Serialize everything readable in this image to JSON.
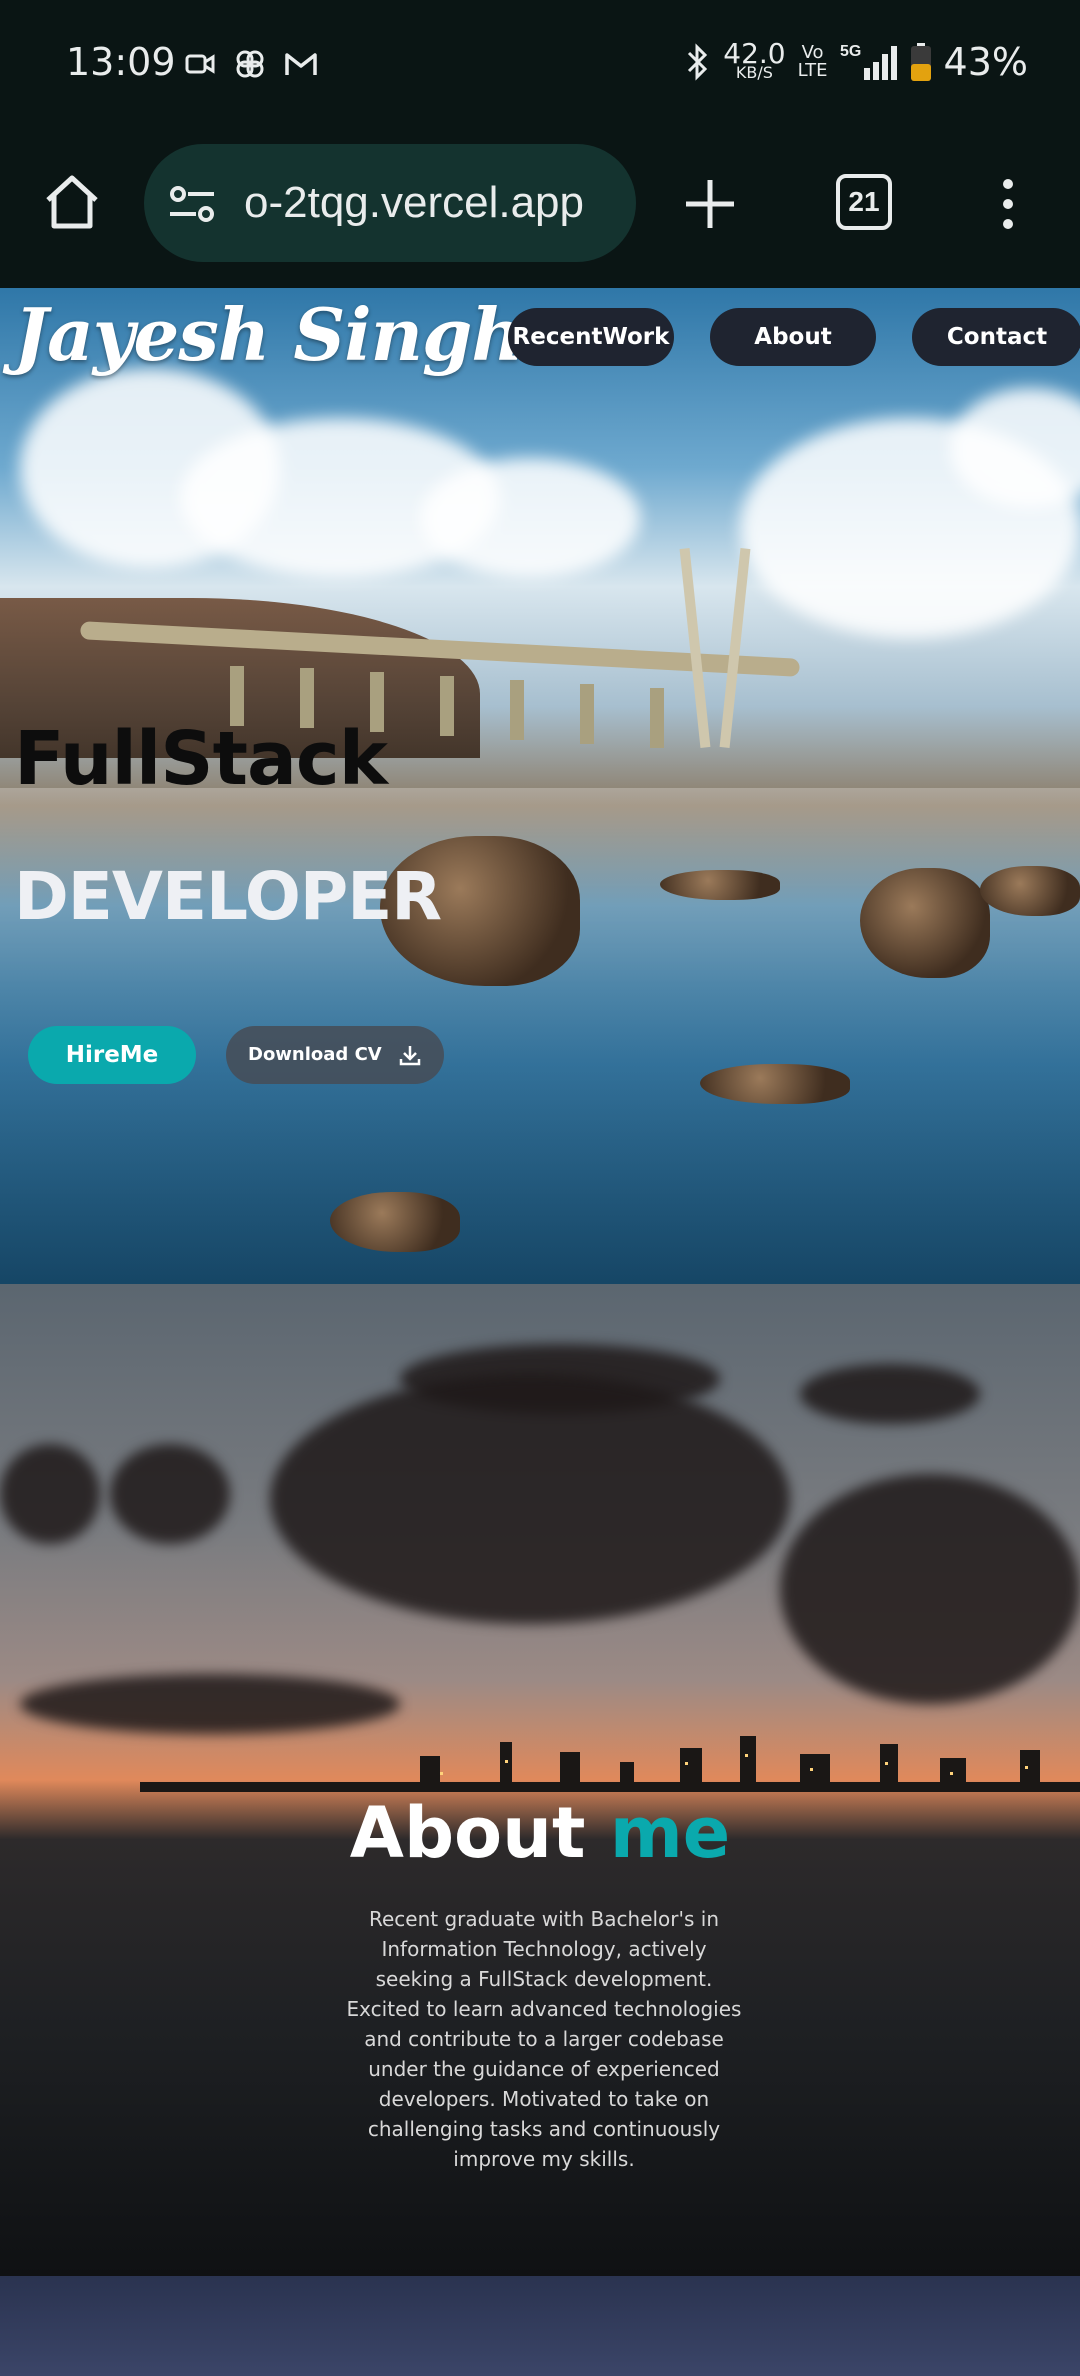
{
  "status_bar": {
    "time": "13:09",
    "speed_value": "42.0",
    "speed_unit": "KB/S",
    "volte_top": "Vo",
    "volte_bottom": "LTE",
    "network": "5G",
    "battery": "43%",
    "left_icons": [
      "video-call-icon",
      "pinwheel-icon",
      "gmail-icon"
    ],
    "right_icons": [
      "bluetooth-icon",
      "signal-icon",
      "battery-icon"
    ]
  },
  "browser": {
    "url": "o-2tqg.vercel.app",
    "tab_count": "21",
    "icons": [
      "home-icon",
      "site-settings-icon",
      "plus-icon",
      "more-vert-icon"
    ]
  },
  "hero": {
    "logo": "Jayesh Singh",
    "nav": [
      "RecentWork",
      "About",
      "Contact"
    ],
    "line1": "FullStack",
    "line2": "DEVELOPER",
    "hire_label": "HireMe",
    "cv_label": "Download CV",
    "cv_icon": "download-icon"
  },
  "about": {
    "title_main": "About ",
    "title_accent": "me",
    "text": "Recent graduate with Bachelor's in Information Technology, actively seeking a FullStack development. Excited to learn advanced technologies and contribute to a larger codebase under the guidance of experienced developers. Motivated to take on challenging tasks and continuously improve my skills."
  },
  "colors": {
    "accent": "#0aa9ad",
    "nav_pill": "#1f2430",
    "browser_bg": "#0a1514",
    "url_bg": "#14332f"
  }
}
